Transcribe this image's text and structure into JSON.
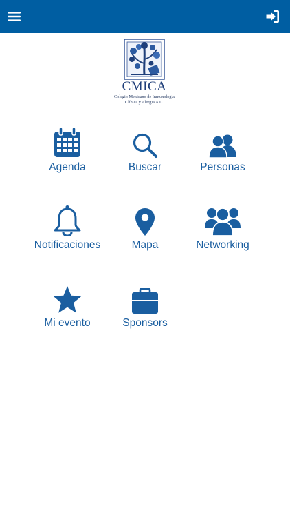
{
  "header": {
    "menu_icon": "hamburger-menu-icon",
    "login_icon": "sign-in-icon",
    "bar_color": "#005ea2"
  },
  "logo": {
    "name": "CMICA",
    "subtitle_line1": "Colegio Mexicano de Inmunología",
    "subtitle_line2": "Clínica y Alergia A.C."
  },
  "menu": {
    "accent_color": "#1a5ea0",
    "items": [
      {
        "label": "Agenda",
        "icon": "calendar-icon"
      },
      {
        "label": "Buscar",
        "icon": "search-icon"
      },
      {
        "label": "Personas",
        "icon": "users-icon"
      },
      {
        "label": "Notificaciones",
        "icon": "bell-icon"
      },
      {
        "label": "Mapa",
        "icon": "map-marker-icon"
      },
      {
        "label": "Networking",
        "icon": "group-icon"
      },
      {
        "label": "Mi evento",
        "icon": "star-icon"
      },
      {
        "label": "Sponsors",
        "icon": "briefcase-icon"
      }
    ]
  }
}
